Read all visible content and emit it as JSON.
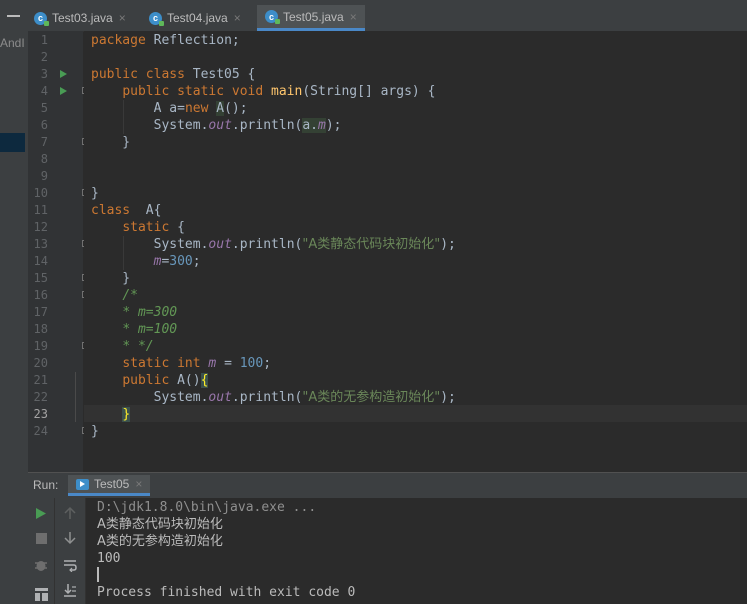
{
  "left_panel": {
    "project_label": "AndI"
  },
  "tabs": [
    {
      "label": "Test03.java",
      "active": false
    },
    {
      "label": "Test04.java",
      "active": false
    },
    {
      "label": "Test05.java",
      "active": true
    }
  ],
  "tab_icon_letter": "c",
  "close_glyph": "×",
  "editor": {
    "current_line": 23,
    "line_numbers": [
      "1",
      "2",
      "3",
      "4",
      "5",
      "6",
      "7",
      "8",
      "9",
      "10",
      "11",
      "12",
      "13",
      "14",
      "15",
      "16",
      "17",
      "18",
      "19",
      "20",
      "21",
      "22",
      "23",
      "24"
    ],
    "code": {
      "l1_kw": "package",
      "l1_rest": " Reflection;",
      "l3_kw": "public class",
      "l3_name": " Test05 {",
      "l4_indent": "    ",
      "l4_kw": "public static void",
      "l4_fn": " main",
      "l4_rest": "(String[] args) {",
      "l5_indent": "        ",
      "l5_a": "A a=",
      "l5_kw": "new",
      "l5_sp": " ",
      "l5_A": "A",
      "l5_rest": "();",
      "l6_indent": "        ",
      "l6_a": "System.",
      "l6_out": "out",
      "l6_b": ".println(",
      "l6_ref_a": "a.",
      "l6_ref_m": "m",
      "l6_c": ");",
      "l7": "    }",
      "l10": "}",
      "l11_kw": "class",
      "l11_rest": "  A{",
      "l12_indent": "    ",
      "l12_kw": "static",
      "l12_rest": " {",
      "l13_indent": "        ",
      "l13_a": "System.",
      "l13_out": "out",
      "l13_b": ".println(",
      "l13_str": "\"A类静态代码块初始化\"",
      "l13_c": ");",
      "l14_indent": "        ",
      "l14_m": "m",
      "l14_eq": "=",
      "l14_num": "300",
      "l14_semi": ";",
      "l15": "    }",
      "l16_indent": "    ",
      "l16": "/*",
      "l17_indent": "    ",
      "l17": "* m=300",
      "l18_indent": "    ",
      "l18": "* m=100",
      "l19_indent": "    ",
      "l19": "* */",
      "l20_indent": "    ",
      "l20_kw": "static int",
      "l20_sp": " ",
      "l20_m": "m",
      "l20_eq": " = ",
      "l20_num": "100",
      "l20_semi": ";",
      "l21_indent": "    ",
      "l21_kw": "public",
      "l21_rest": " A()",
      "l21_brace": "{",
      "l22_indent": "        ",
      "l22_a": "System.",
      "l22_out": "out",
      "l22_b": ".println(",
      "l22_str": "\"A类的无参构造初始化\"",
      "l22_c": ");",
      "l23_indent": "    ",
      "l23_brace": "}",
      "l24": "}"
    }
  },
  "run_panel": {
    "label": "Run:",
    "tab_label": "Test05",
    "console_lines": [
      "D:\\jdk1.8.0\\bin\\java.exe ...",
      "A类静态代码块初始化",
      "A类的无参构造初始化",
      "100",
      "",
      "Process finished with exit code 0"
    ]
  },
  "icons": {
    "run": "run-icon",
    "stop": "stop-icon",
    "up": "up-arrow-icon",
    "down": "down-arrow-icon",
    "soft_wrap": "soft-wrap-icon",
    "scroll_end": "scroll-to-end-icon",
    "bug": "bug-icon",
    "layout": "layout-icon"
  },
  "colors": {
    "background": "#2b2b2b",
    "keyword": "#cc7832",
    "function": "#ffc66d",
    "string": "#6a8759",
    "number": "#6897bb",
    "field": "#9876aa",
    "comment": "#629755",
    "accent": "#4a88c7",
    "run_green": "#499c54"
  }
}
